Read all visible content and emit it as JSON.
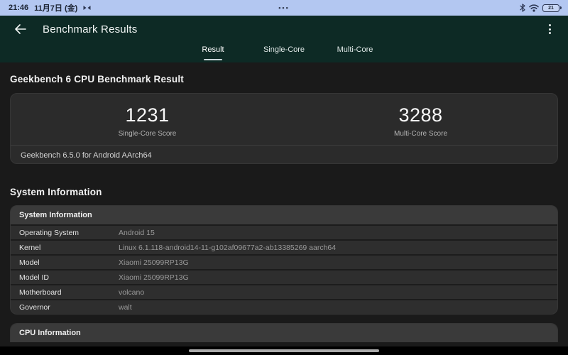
{
  "status_bar": {
    "time": "21:46",
    "date": "11月7日 (金)",
    "center_dots": "•••",
    "battery_percent": "21"
  },
  "app_bar": {
    "title": "Benchmark Results",
    "tabs": [
      {
        "label": "Result"
      },
      {
        "label": "Single-Core"
      },
      {
        "label": "Multi-Core"
      }
    ]
  },
  "main": {
    "result_heading": "Geekbench 6 CPU Benchmark Result",
    "scores": [
      {
        "value": "1231",
        "label": "Single-Core Score"
      },
      {
        "value": "3288",
        "label": "Multi-Core Score"
      }
    ],
    "score_footer": "Geekbench 6.5.0 for Android AArch64",
    "system_heading": "System Information",
    "system_table": {
      "header": "System Information",
      "rows": [
        {
          "label": "Operating System",
          "value": "Android 15"
        },
        {
          "label": "Kernel",
          "value": "Linux 6.1.118-android14-11-g102af09677a2-ab13385269 aarch64"
        },
        {
          "label": "Model",
          "value": "Xiaomi 25099RP13G"
        },
        {
          "label": "Model ID",
          "value": "Xiaomi 25099RP13G"
        },
        {
          "label": "Motherboard",
          "value": "volcano"
        },
        {
          "label": "Governor",
          "value": "walt"
        }
      ]
    },
    "cpu_table": {
      "header": "CPU Information"
    }
  },
  "colors": {
    "status_bar_bg": "#b3c7f1",
    "app_bar_bg": "#0d2a25",
    "page_bg": "#1a1a1a",
    "card_bg": "#2b2b2b",
    "table_header_bg": "#3a3a3a",
    "tab_indicator": "#c9d7da"
  }
}
